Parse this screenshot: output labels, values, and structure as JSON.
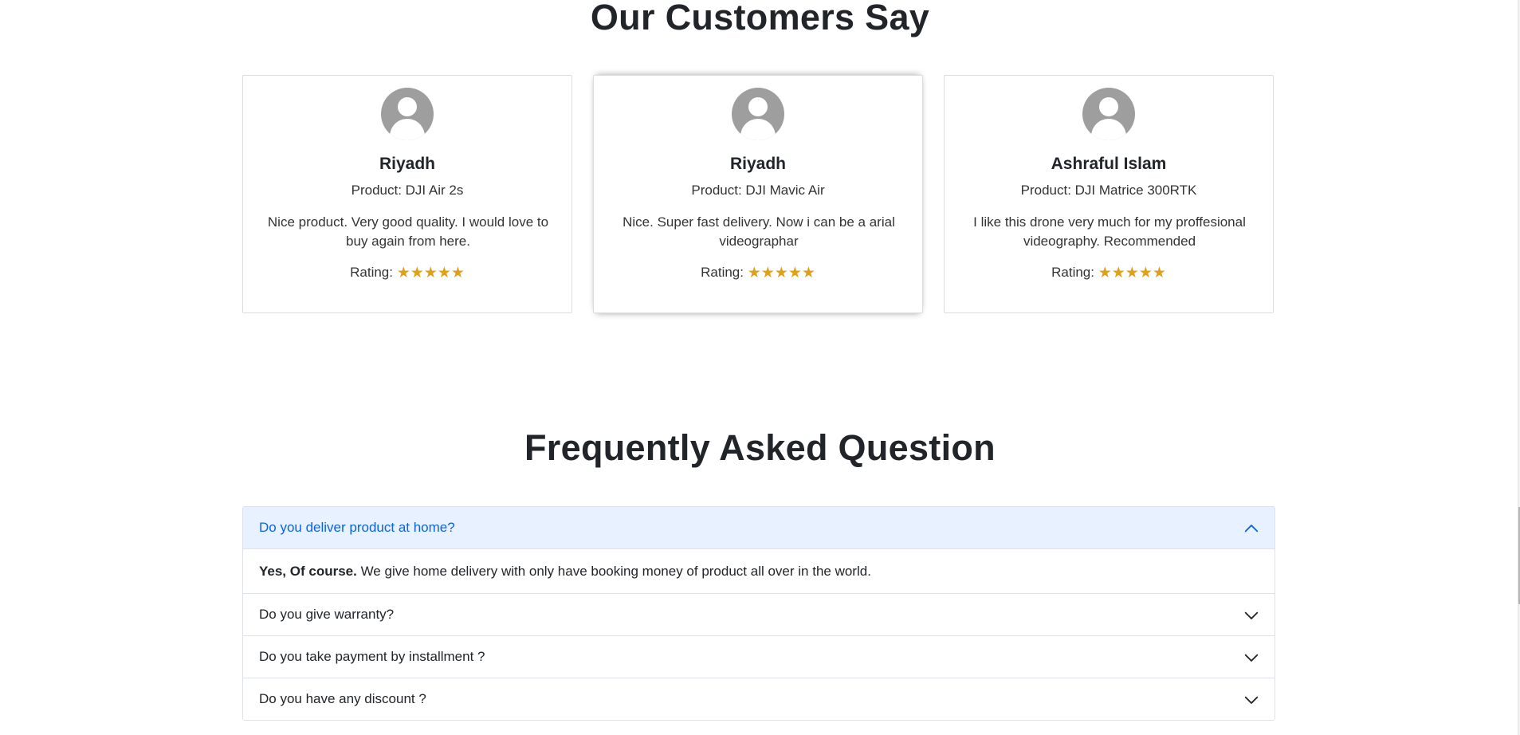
{
  "customers_section": {
    "title": "Our Customers Say",
    "reviews": [
      {
        "name": "Riyadh",
        "product": "Product: DJI Air 2s",
        "comment": "Nice product. Very good quality. I would love to buy again from here.",
        "rating_label": "Rating:",
        "stars": "★★★★★",
        "rating": 5
      },
      {
        "name": "Riyadh",
        "product": "Product: DJI Mavic Air",
        "comment": "Nice. Super fast delivery. Now i can be a arial videographar",
        "rating_label": "Rating:",
        "stars": "★★★★★",
        "rating": 5
      },
      {
        "name": "Ashraful Islam",
        "product": "Product: DJI Matrice 300RTK",
        "comment": "I like this drone very much for my proffesional videography. Recommended",
        "rating_label": "Rating:",
        "stars": "★★★★★",
        "rating": 5
      }
    ]
  },
  "faq_section": {
    "title": "Frequently Asked Question",
    "items": [
      {
        "question": "Do you deliver product at home?",
        "expanded": true,
        "answer_bold": "Yes, Of course.",
        "answer_rest": " We give home delivery with only have booking money of product all over in the world."
      },
      {
        "question": "Do you give warranty?",
        "expanded": false
      },
      {
        "question": "Do you take payment by installment ?",
        "expanded": false
      },
      {
        "question": "Do you have any discount ?",
        "expanded": false
      }
    ]
  },
  "colors": {
    "star": "#e0a019",
    "accordion_active_bg": "#e7f1ff",
    "accordion_active_text": "#0c63e4",
    "avatar": "#9e9e9e"
  },
  "icons": {
    "avatar": "user-avatar-icon",
    "star": "star-icon",
    "chevron_up": "chevron-up-icon",
    "chevron_down": "chevron-down-icon"
  }
}
